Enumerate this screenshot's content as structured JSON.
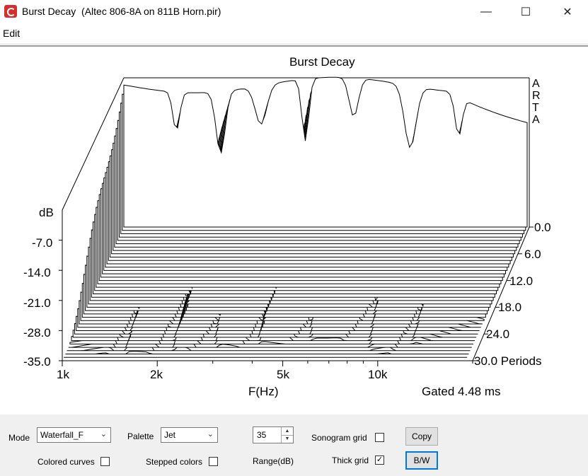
{
  "window": {
    "title": "Burst Decay  (Altec 806-8A on 811B Horn.pir)",
    "minimize_glyph": "—",
    "maximize_glyph": "☐",
    "close_glyph": "✕"
  },
  "menu": {
    "edit": "Edit"
  },
  "chart": {
    "title": "Burst Decay",
    "watermark": [
      "A",
      "R",
      "T",
      "A"
    ],
    "y_axis_title": "dB",
    "y_ticks": [
      "-7.0",
      "-14.0",
      "-21.0",
      "-28.0",
      "-35.0"
    ],
    "x_ticks": [
      "1k",
      "2k",
      "5k",
      "10k"
    ],
    "x_label": "F(Hz)",
    "period_ticks": [
      "0.0",
      "6.0",
      "12.0",
      "18.0",
      "24.0",
      "30.0 Periods"
    ],
    "gated_text": "Gated 4.48 ms"
  },
  "chart_data": {
    "type": "waterfall",
    "title": "Burst Decay",
    "xlabel": "F(Hz)",
    "ylabel": "dB",
    "zlabel": "Periods",
    "x_scale": "log",
    "xlim": [
      1000,
      20000
    ],
    "ylim": [
      -35,
      0
    ],
    "zlim": [
      0,
      30
    ],
    "x_ticks": [
      1000,
      2000,
      5000,
      10000
    ],
    "y_ticks": [
      -7,
      -14,
      -21,
      -28,
      -35
    ],
    "z_ticks": [
      0,
      6,
      12,
      18,
      24,
      30
    ],
    "annotation": "Gated 4.48 ms"
  },
  "controls": {
    "mode_label": "Mode",
    "mode_value": "Waterfall_F",
    "palette_label": "Palette",
    "palette_value": "Jet",
    "range_value": "35",
    "range_label": "Range(dB)",
    "sonogram_grid_label": "Sonogram grid",
    "sonogram_grid_checked": false,
    "thick_grid_label": "Thick grid",
    "thick_grid_checked": true,
    "colored_curves_label": "Colored curves",
    "colored_curves_checked": false,
    "stepped_colors_label": "Stepped colors",
    "stepped_colors_checked": false,
    "copy_label": "Copy",
    "bw_label": "B/W",
    "dropdown_arrow": "⌄",
    "spin_up": "▲",
    "spin_down": "▼",
    "check_mark": "✓"
  }
}
